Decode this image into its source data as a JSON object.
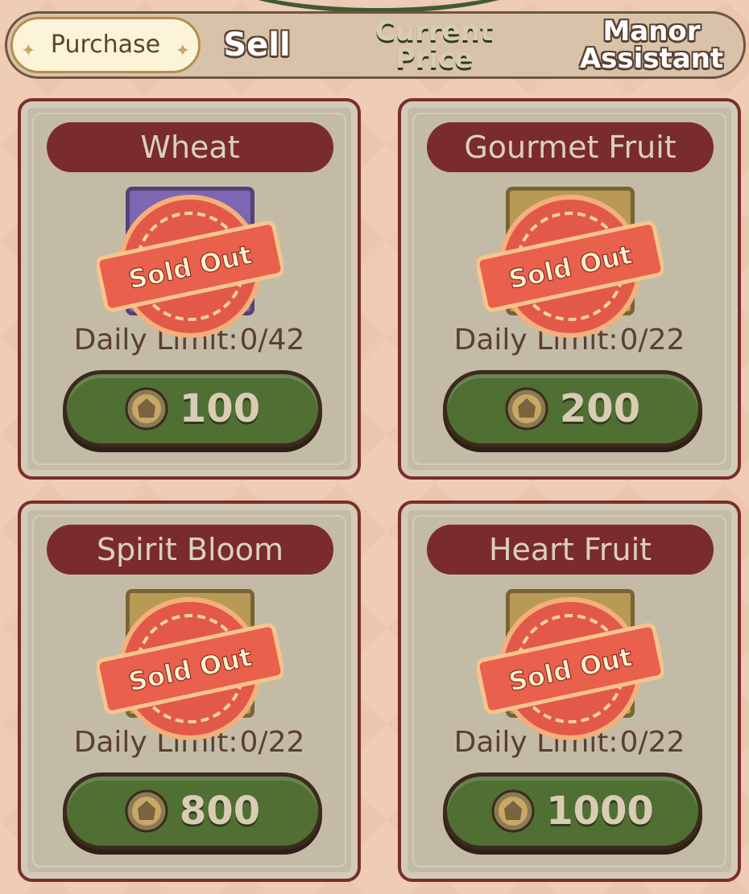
{
  "tabs": {
    "purchase": "Purchase",
    "sell": "Sell",
    "current_price": "Current Price",
    "manor_assistant": "Manor Assistant"
  },
  "items": [
    {
      "name": "Wheat",
      "daily_limit_label": "Daily Limit:",
      "daily_limit_value": "0/42",
      "price": "100",
      "status": "Sold Out",
      "icon_frame": "purple"
    },
    {
      "name": "Gourmet Fruit",
      "daily_limit_label": "Daily Limit:",
      "daily_limit_value": "0/22",
      "price": "200",
      "status": "Sold Out",
      "icon_frame": "gold"
    },
    {
      "name": "Spirit Bloom",
      "daily_limit_label": "Daily Limit:",
      "daily_limit_value": "0/22",
      "price": "800",
      "status": "Sold Out",
      "icon_frame": "gold"
    },
    {
      "name": "Heart Fruit",
      "daily_limit_label": "Daily Limit:",
      "daily_limit_value": "0/22",
      "price": "1000",
      "status": "Sold Out",
      "icon_frame": "gold"
    }
  ],
  "colors": {
    "background": "#ecc6ad",
    "card_border": "#7a2e2c",
    "button_green": "#4f6f33",
    "stamp_red": "#e2594a"
  },
  "icons": {
    "coin": "coin-icon",
    "sparkle": "sparkle-icon"
  }
}
